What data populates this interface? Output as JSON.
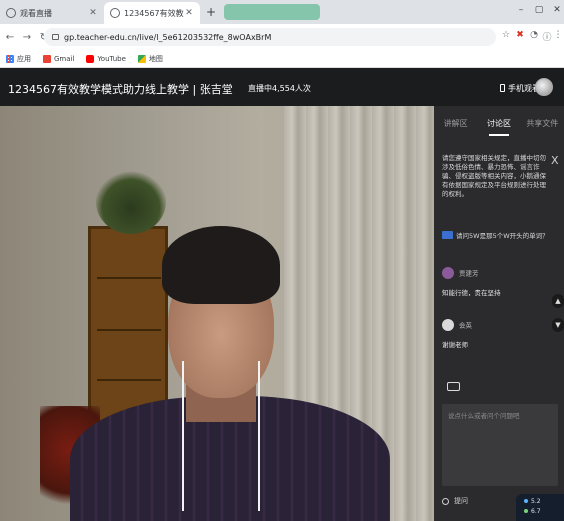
{
  "browser": {
    "tabs": [
      {
        "title": "观看直播",
        "active": false
      },
      {
        "title": "1234567有效教学模式助力线上教",
        "active": true
      },
      {
        "title": "",
        "active": false
      }
    ],
    "new_tab": "+",
    "url": "gp.teacher-edu.cn/live/l_5e61203532ffe_8wOAxBrM",
    "bookmarks": [
      "应用",
      "Gmail",
      "YouTube",
      "地图"
    ],
    "colors": {
      "tabstrip": "#dee1e6",
      "gmail": "#ea4335",
      "youtube": "#ff0000"
    }
  },
  "header": {
    "course_title": "1234567有效教学模式助力线上教学 | 张吉堂",
    "live_status": "直播中",
    "viewer_count": "4,554人次",
    "mobile_watch": "手机观看"
  },
  "panel": {
    "tabs": [
      "讲解区",
      "讨论区",
      "共享文件"
    ],
    "active_tab": "讨论区",
    "notice": "请您遵守国家相关规定，直播中切勿涉及低俗色情、暴力恐怖、谣言诈骗、侵权盗版等相关内容，小鹅通保有依据国家规定及平台规则进行处理的权利。",
    "question_link": "请问5W是那5个W开头的单词？",
    "messages": [
      {
        "name": "贾建芳",
        "text": "知能行德，贵在坚持",
        "avatar_color": "#8a5a9a"
      },
      {
        "name": "会英",
        "text": "谢谢老师",
        "avatar_color": "#d9d9d9"
      }
    ],
    "input_placeholder": "说点什么或者问个问题吧",
    "anonymous_label": "提问",
    "net_speed": [
      "5.2",
      "6.7"
    ]
  }
}
